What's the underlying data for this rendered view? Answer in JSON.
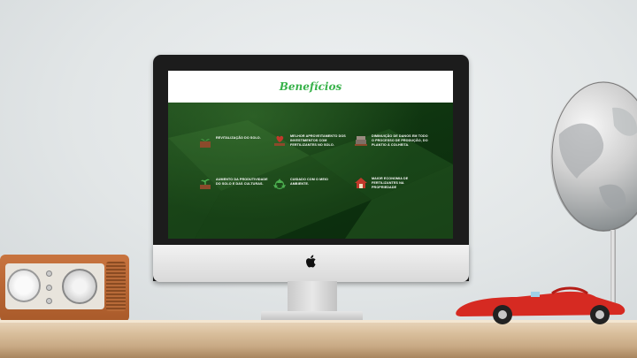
{
  "page": {
    "title": "Benefícios"
  },
  "benefits": [
    {
      "icon": "soil-box-icon",
      "text": "REVITALIZAÇÃO DO SOLO."
    },
    {
      "icon": "heart-hand-icon",
      "text": "MELHOR APROVEITAMENTO DOS INVESTIMENTOS COM FERTILIZANTES NO SOLO."
    },
    {
      "icon": "machine-icon",
      "text": "DIMINUIÇÃO DE DANOS EM TODO O PROCESSO DE PRODUÇÃO, DO PLANTIO À COLHEITA."
    },
    {
      "icon": "plant-growth-icon",
      "text": "AUMENTO DA PRODUTIVIDADE DO SOLO E DAS CULTURAS."
    },
    {
      "icon": "recycle-icon",
      "text": "CUIDADO COM O MEIO AMBIENTE."
    },
    {
      "icon": "house-icon",
      "text": "MAIOR ECONOMIA DE FERTILIZANTES NA PROPRIEDADE"
    }
  ],
  "colors": {
    "title_green": "#38b24a",
    "background_green": "#0f3a12",
    "icon_brown": "#8b4a2b",
    "icon_green": "#4caf50"
  }
}
